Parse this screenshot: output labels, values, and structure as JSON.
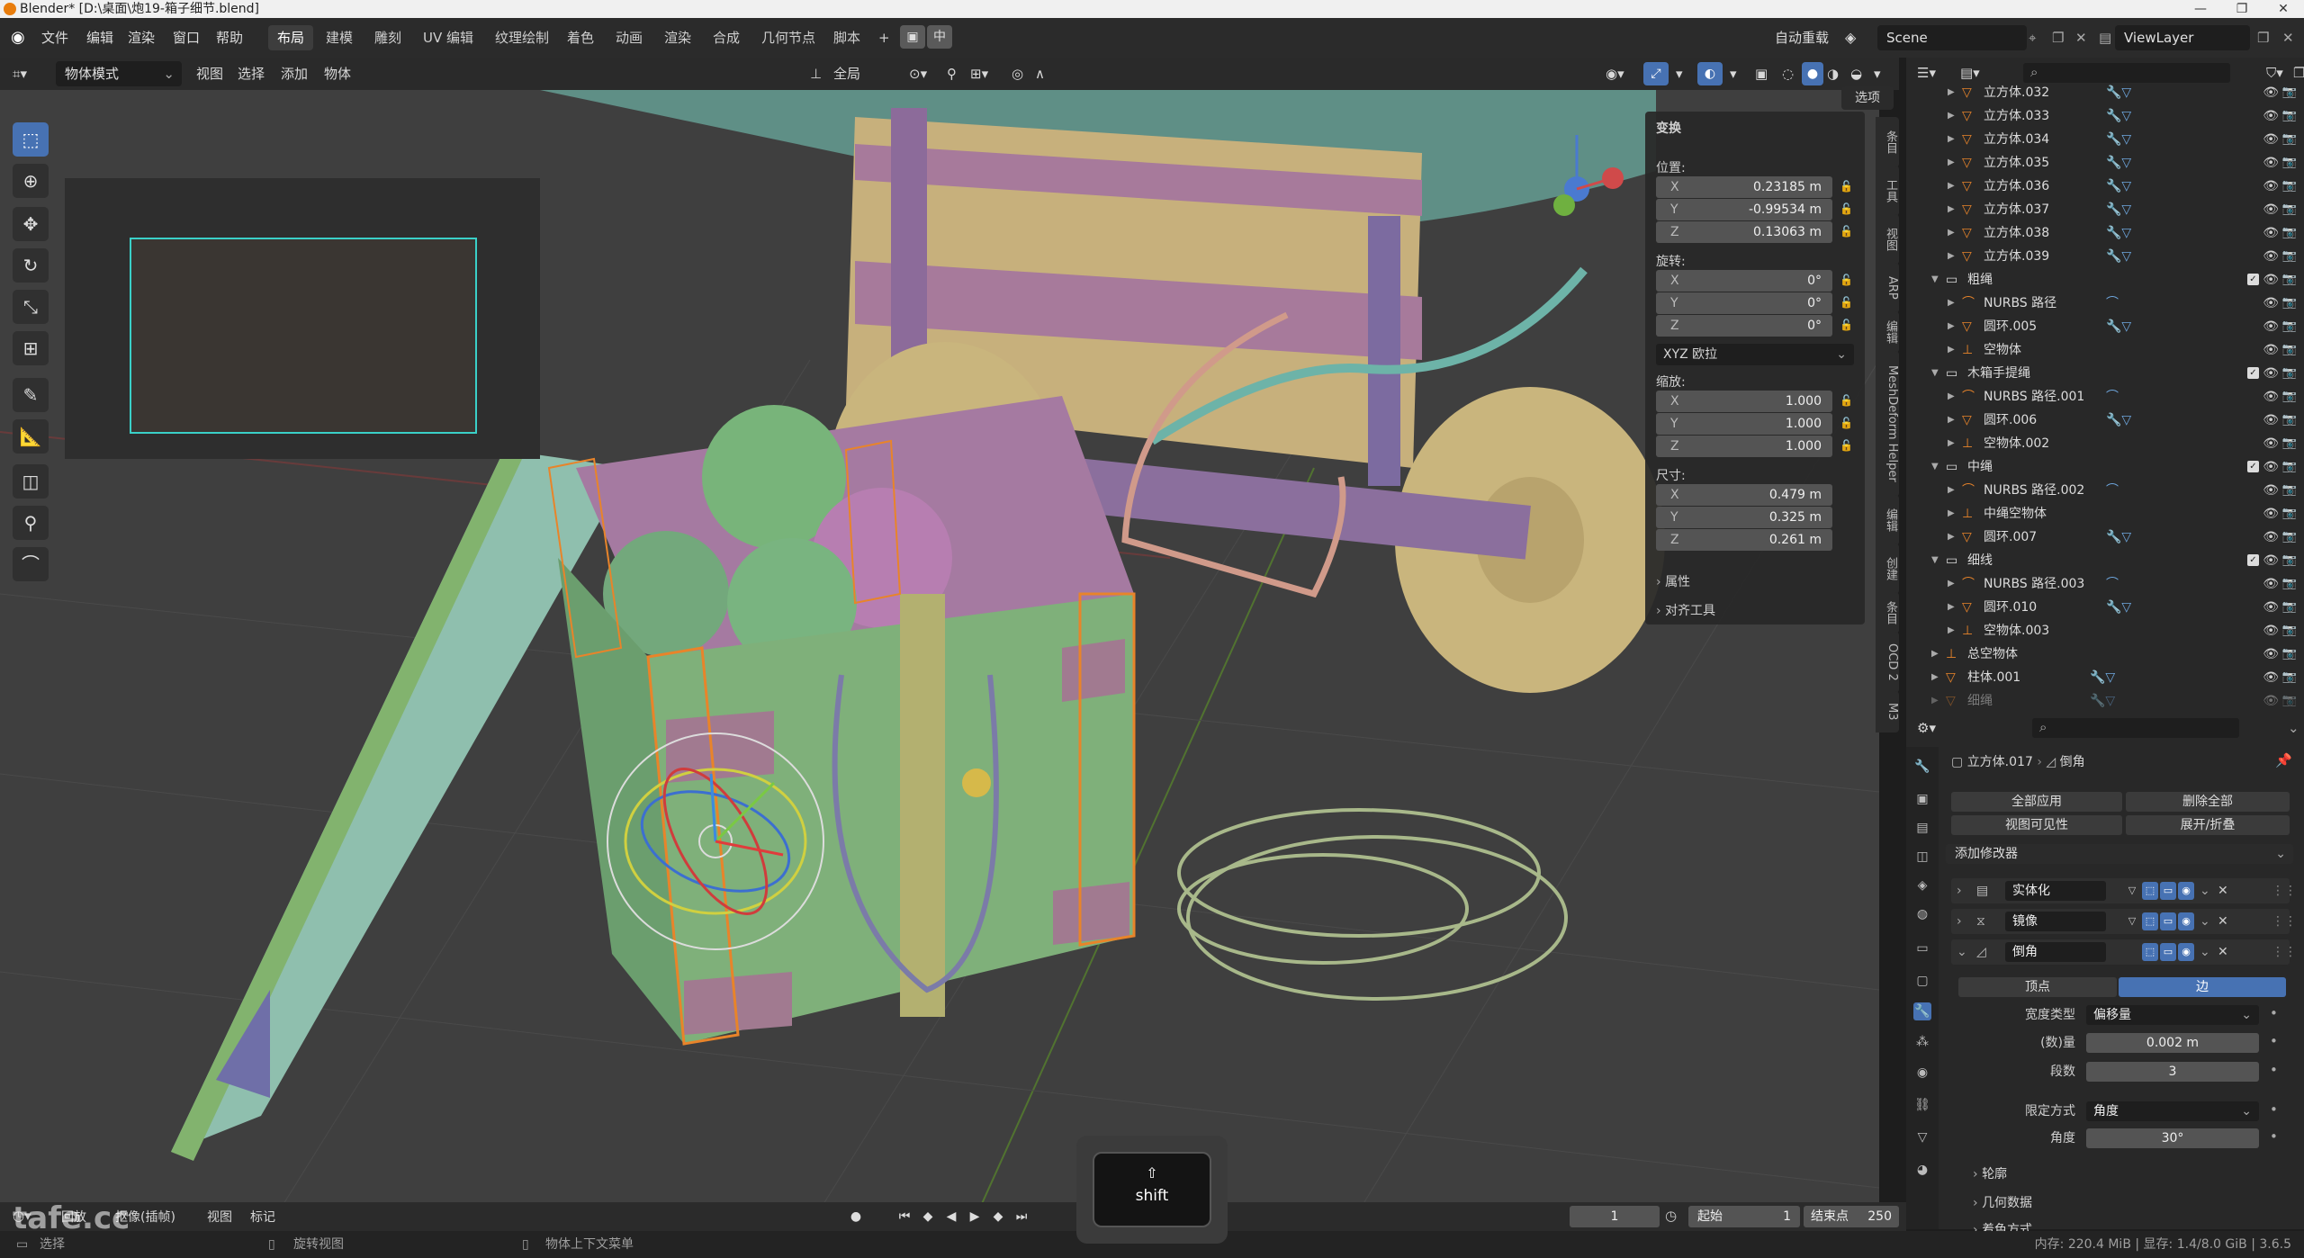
{
  "window": {
    "title": "Blender* [D:\\桌面\\炮19-箱子细节.blend]",
    "controls": [
      "—",
      "❐",
      "✕"
    ]
  },
  "menubar": {
    "menus": [
      "文件",
      "编辑",
      "渲染",
      "窗口",
      "帮助"
    ],
    "workspaces": [
      "布局",
      "建模",
      "雕刻",
      "UV 编辑",
      "纹理绘制",
      "着色",
      "动画",
      "渲染",
      "合成",
      "几何节点",
      "脚本"
    ],
    "active_workspace": "布局",
    "add_tab": "+",
    "lang_toggle": "中",
    "auto_save": "自动重载",
    "scene": "Scene",
    "view_layer": "ViewLayer"
  },
  "viewport_header": {
    "mode": "物体模式",
    "menus": [
      "视图",
      "选择",
      "添加",
      "物体"
    ],
    "transform_orientation": "全局",
    "options": "选项"
  },
  "npanel": {
    "section_transform": "变换",
    "location_label": "位置:",
    "location": [
      {
        "axis": "X",
        "value": "0.23185 m"
      },
      {
        "axis": "Y",
        "value": "-0.99534 m"
      },
      {
        "axis": "Z",
        "value": "0.13063 m"
      }
    ],
    "rotation_label": "旋转:",
    "rotation": [
      {
        "axis": "X",
        "value": "0°"
      },
      {
        "axis": "Y",
        "value": "0°"
      },
      {
        "axis": "Z",
        "value": "0°"
      }
    ],
    "rotation_mode": "XYZ 欧拉",
    "scale_label": "缩放:",
    "scale": [
      {
        "axis": "X",
        "value": "1.000"
      },
      {
        "axis": "Y",
        "value": "1.000"
      },
      {
        "axis": "Z",
        "value": "1.000"
      }
    ],
    "dimensions_label": "尺寸:",
    "dimensions": [
      {
        "axis": "X",
        "value": "0.479 m"
      },
      {
        "axis": "Y",
        "value": "0.325 m"
      },
      {
        "axis": "Z",
        "value": "0.261 m"
      }
    ],
    "section_properties": "属性",
    "section_align": "对齐工具"
  },
  "side_tabs": [
    "条目",
    "工具",
    "视图",
    "ARP",
    "编辑",
    "MeshDeform Helper",
    "编辑",
    "创建",
    "条目",
    "OCD 2",
    "M3"
  ],
  "outliner": {
    "rows": [
      {
        "label": "立方体.032",
        "depth": 2,
        "type": "mesh"
      },
      {
        "label": "立方体.033",
        "depth": 2,
        "type": "mesh"
      },
      {
        "label": "立方体.034",
        "depth": 2,
        "type": "mesh"
      },
      {
        "label": "立方体.035",
        "depth": 2,
        "type": "mesh"
      },
      {
        "label": "立方体.036",
        "depth": 2,
        "type": "mesh"
      },
      {
        "label": "立方体.037",
        "depth": 2,
        "type": "mesh"
      },
      {
        "label": "立方体.038",
        "depth": 2,
        "type": "mesh"
      },
      {
        "label": "立方体.039",
        "depth": 2,
        "type": "mesh"
      },
      {
        "label": "粗绳",
        "depth": 1,
        "type": "collection"
      },
      {
        "label": "NURBS 路径",
        "depth": 2,
        "type": "curve"
      },
      {
        "label": "圆环.005",
        "depth": 2,
        "type": "mesh"
      },
      {
        "label": "空物体",
        "depth": 2,
        "type": "empty"
      },
      {
        "label": "木箱手提绳",
        "depth": 1,
        "type": "collection"
      },
      {
        "label": "NURBS 路径.001",
        "depth": 2,
        "type": "curve"
      },
      {
        "label": "圆环.006",
        "depth": 2,
        "type": "mesh"
      },
      {
        "label": "空物体.002",
        "depth": 2,
        "type": "empty"
      },
      {
        "label": "中绳",
        "depth": 1,
        "type": "collection"
      },
      {
        "label": "NURBS 路径.002",
        "depth": 2,
        "type": "curve"
      },
      {
        "label": "中绳空物体",
        "depth": 2,
        "type": "empty"
      },
      {
        "label": "圆环.007",
        "depth": 2,
        "type": "mesh"
      },
      {
        "label": "细线",
        "depth": 1,
        "type": "collection"
      },
      {
        "label": "NURBS 路径.003",
        "depth": 2,
        "type": "curve"
      },
      {
        "label": "圆环.010",
        "depth": 2,
        "type": "mesh"
      },
      {
        "label": "空物体.003",
        "depth": 2,
        "type": "empty"
      },
      {
        "label": "总空物体",
        "depth": 1,
        "type": "empty"
      },
      {
        "label": "柱体.001",
        "depth": 1,
        "type": "mesh"
      },
      {
        "label": "细绳",
        "depth": 1,
        "type": "mesh"
      }
    ]
  },
  "properties": {
    "breadcrumb_object": "立方体.017",
    "breadcrumb_modifier": "倒角",
    "apply_all": "全部应用",
    "delete_all": "删除全部",
    "viewport_vis": "视图可见性",
    "expand_collapse": "展开/折叠",
    "add_modifier": "添加修改器",
    "modifiers": [
      "实体化",
      "镜像",
      "倒角"
    ],
    "bevel": {
      "tab_vertices": "顶点",
      "tab_edges": "边",
      "width_type_label": "宽度类型",
      "width_type": "偏移量",
      "amount_label": "(数)量",
      "amount": "0.002 m",
      "segments_label": "段数",
      "segments": "3",
      "limit_method_label": "限定方式",
      "limit_method": "角度",
      "angle_label": "角度",
      "angle": "30°",
      "profile": "轮廓",
      "geometry": "几何数据",
      "shading": "着色方式"
    }
  },
  "timeline": {
    "playback": "回放",
    "keying": "抠像(插帧)",
    "view": "视图",
    "marker": "标记",
    "current_frame": "1",
    "start_label": "起始",
    "start": "1",
    "end_label": "结束点",
    "end": "250"
  },
  "statusbar": {
    "select": "选择",
    "rotate_view": "旋转视图",
    "context_menu": "物体上下文菜单",
    "stats": "内存: 220.4 MiB | 显存: 1.4/8.0 GiB | 3.6.5"
  },
  "key_overlay": {
    "symbol": "⇧",
    "label": "shift"
  },
  "watermark": "tafe.cc",
  "colors": {
    "accent": "#4772b3",
    "selection": "#e8842a",
    "viewport": "#3f3f3f"
  }
}
